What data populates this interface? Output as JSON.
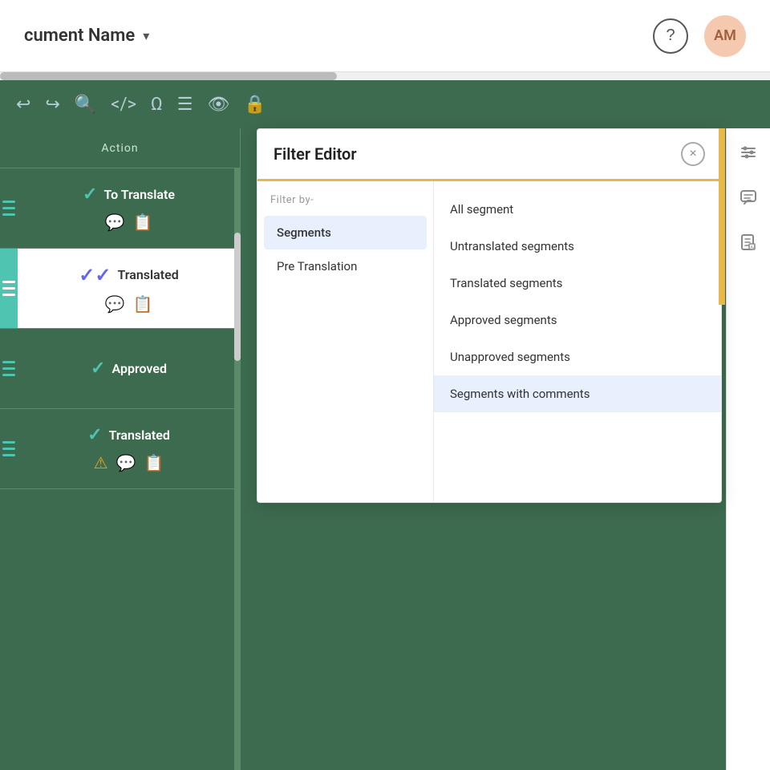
{
  "header": {
    "doc_name": "cument Name",
    "chevron": "▾",
    "help_icon": "?",
    "avatar_initials": "AM"
  },
  "toolbar": {
    "icons": [
      "↩",
      "↪",
      "⊕",
      "</>",
      "👁",
      "≡",
      "⊘",
      "🔒"
    ]
  },
  "action_column": {
    "header": "Action",
    "segments": [
      {
        "id": "seg1",
        "side_bar_color": "#4fc4b0",
        "status_icon": "✓",
        "status_label": "To Translate",
        "status_color": "#3d6b4f",
        "icon1": "💬",
        "icon2": "📋"
      },
      {
        "id": "seg2",
        "side_bar_color": "#4fc4b0",
        "status_icon": "✓✓",
        "status_label": "Translated",
        "status_color": "#6366f1",
        "icon1": "💬",
        "icon2": "📋",
        "selected": true
      },
      {
        "id": "seg3",
        "side_bar_color": "#4fc4b0",
        "status_icon": "✓",
        "status_label": "Approved",
        "status_color": "#4fc4b0",
        "icon1": "",
        "icon2": ""
      },
      {
        "id": "seg4",
        "side_bar_color": "#4fc4b0",
        "status_icon": "✓",
        "status_label": "Translated",
        "status_color": "#4fc4b0",
        "icon1": "⚠",
        "icon2": "💬",
        "icon3": "📋"
      }
    ]
  },
  "filter_editor": {
    "title": "Filter Editor",
    "close_label": "×",
    "filter_by_label": "Filter by-",
    "categories": [
      {
        "id": "segments",
        "label": "Segments",
        "active": true
      },
      {
        "id": "pre_translation",
        "label": "Pre Translation",
        "active": false
      }
    ],
    "options": [
      {
        "id": "all",
        "label": "All segment",
        "selected": false
      },
      {
        "id": "untranslated",
        "label": "Untranslated segments",
        "selected": false
      },
      {
        "id": "translated",
        "label": "Translated segments",
        "selected": false
      },
      {
        "id": "approved",
        "label": "Approved segments",
        "selected": false
      },
      {
        "id": "unapproved",
        "label": "Unapproved segments",
        "selected": false
      },
      {
        "id": "comments",
        "label": "Segments with comments",
        "selected": true
      }
    ]
  },
  "right_sidebar": {
    "icons": [
      {
        "name": "filter-icon",
        "symbol": "≡"
      },
      {
        "name": "comment-icon",
        "symbol": "💬"
      },
      {
        "name": "dictionary-icon",
        "symbol": "📖"
      }
    ]
  }
}
